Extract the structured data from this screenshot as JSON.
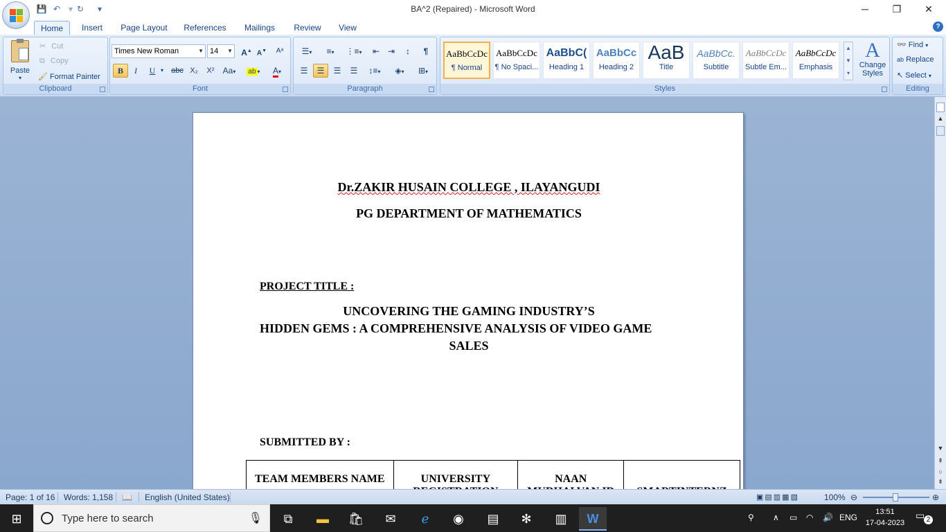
{
  "window": {
    "title": "BA^2 (Repaired) - Microsoft Word",
    "controls": {
      "minimize": "─",
      "maximize": "❐",
      "close": "✕"
    }
  },
  "qat": {
    "save": "💾",
    "undo": "↶",
    "redo": "↻",
    "customize": "▾"
  },
  "tabs": [
    "Home",
    "Insert",
    "Page Layout",
    "Mailings",
    "References",
    "Review",
    "View"
  ],
  "tabs_ordered": [
    "Home",
    "Insert",
    "Page Layout",
    "References",
    "Mailings",
    "Review",
    "View"
  ],
  "ribbon": {
    "clipboard": {
      "label": "Clipboard",
      "paste": "Paste",
      "cut": "Cut",
      "copy": "Copy",
      "format_painter": "Format Painter"
    },
    "font": {
      "label": "Font",
      "font_name": "Times New Roman",
      "font_size": "14",
      "bold": "B",
      "italic": "I",
      "underline": "U",
      "strike": "abc",
      "subscript": "X₂",
      "superscript": "X²",
      "change_case": "Aa",
      "grow": "A",
      "shrink": "A"
    },
    "paragraph": {
      "label": "Paragraph"
    },
    "styles": {
      "label": "Styles",
      "items": [
        {
          "sample": "AaBbCcDc",
          "name": "¶ Normal"
        },
        {
          "sample": "AaBbCcDc",
          "name": "¶ No Spaci..."
        },
        {
          "sample": "AaBbC(",
          "name": "Heading 1"
        },
        {
          "sample": "AaBbCc",
          "name": "Heading 2"
        },
        {
          "sample": "AaB",
          "name": "Title"
        },
        {
          "sample": "AaBbCc.",
          "name": "Subtitle"
        },
        {
          "sample": "AaBbCcDc",
          "name": "Subtle Em..."
        },
        {
          "sample": "AaBbCcDc",
          "name": "Emphasis"
        }
      ],
      "change_styles": "Change Styles"
    },
    "editing": {
      "label": "Editing",
      "find": "Find",
      "replace": "Replace",
      "select": "Select"
    }
  },
  "document": {
    "college": "Dr.ZAKIR HUSAIN COLLEGE , ILAYANGUDI",
    "department": "PG DEPARTMENT OF MATHEMATICS",
    "project_title_label": "PROJECT TITLE :",
    "title_line1": "UNCOVERING THE  GAMING  INDUSTRY’S",
    "title_line2": "HIDDEN GEMS : A  COMPREHENSIVE ANALYSIS OF VIDEO GAME",
    "title_line3": "SALES",
    "submitted_by": "SUBMITTED BY :",
    "table_headers": [
      "TEAM MEMBERS NAME",
      "UNIVERSITY REGISTRATION",
      "NAAN MUDHALVAN ID",
      "SMARTINTERNZ"
    ]
  },
  "statusbar": {
    "page": "Page: 1 of 16",
    "words": "Words: 1,158",
    "language": "English (United States)",
    "zoom": "100%"
  },
  "taskbar": {
    "search_placeholder": "Type here to search",
    "language": "ENG",
    "time": "13:51",
    "date": "17-04-2023",
    "notifications": "2"
  }
}
